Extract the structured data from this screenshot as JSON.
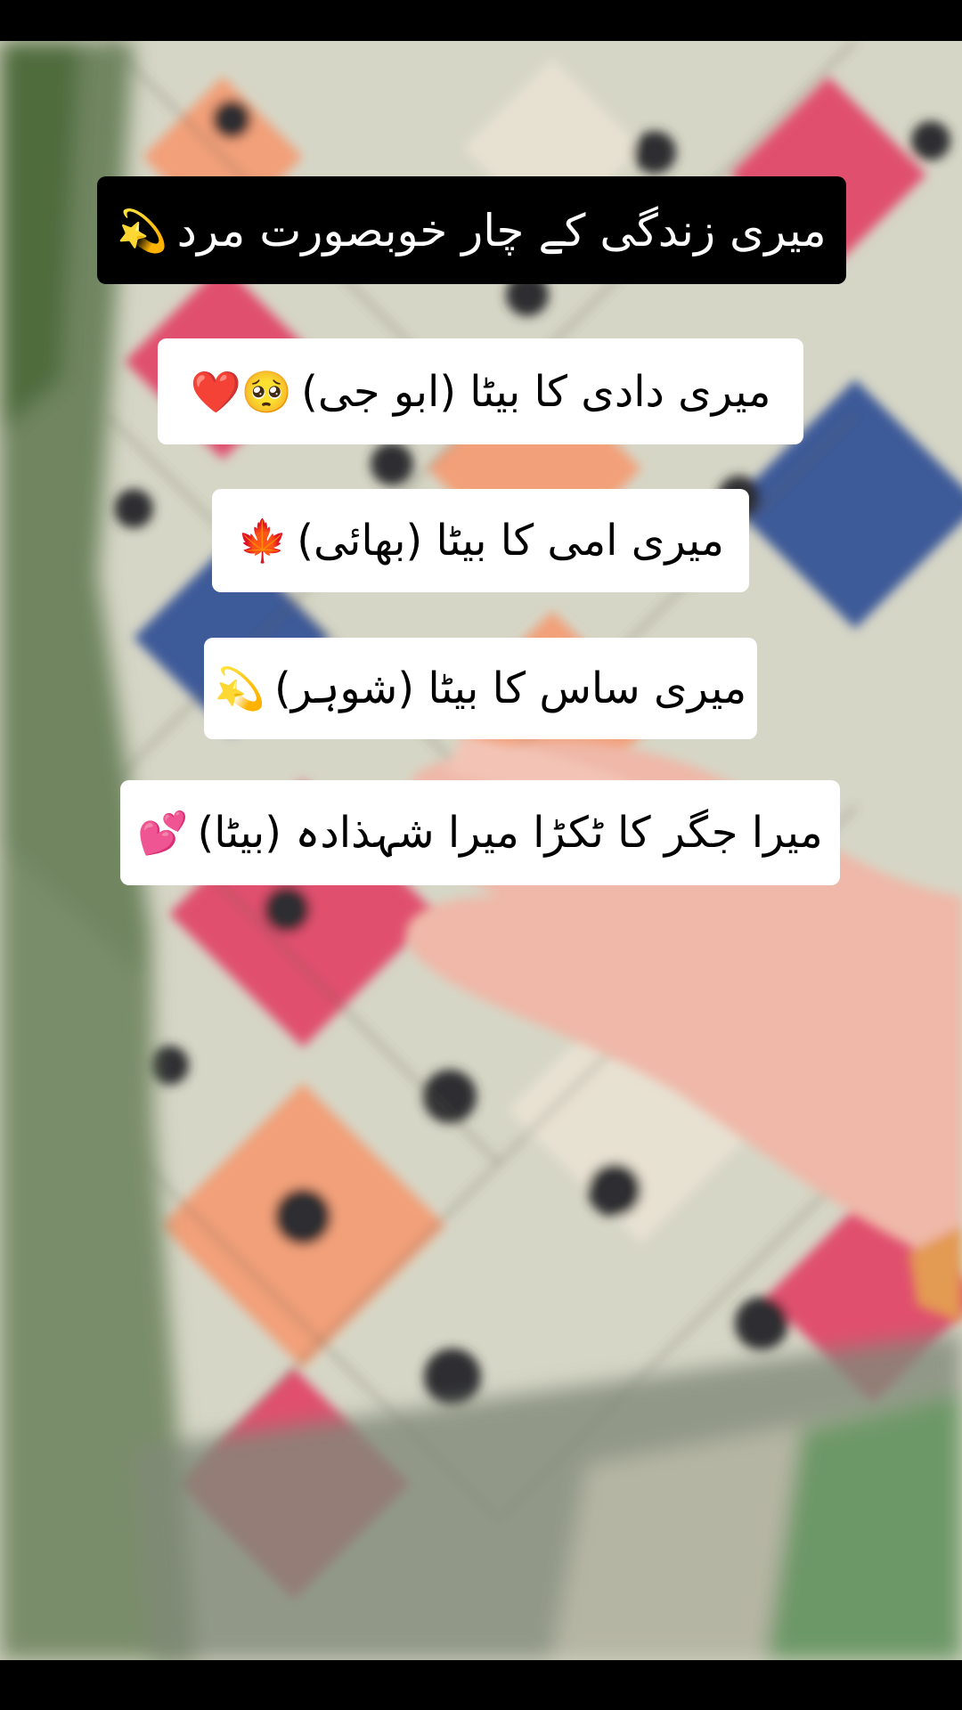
{
  "title": {
    "text": "میری زندگی کے چار خوبصورت مرد",
    "emoji": "💫"
  },
  "captions": [
    {
      "text": "میری دادی کا بیٹا (ابو جی)",
      "emoji": "🥺❤️"
    },
    {
      "text": "میری امی کا بیٹا (بھائی)",
      "emoji": "🍁"
    },
    {
      "text": "میری ساس کا بیٹا (شوہر)",
      "emoji": "💫"
    },
    {
      "text": "میرا جگر کا ٹکڑا میرا شہذادہ (بیٹا)",
      "emoji": "💕"
    }
  ],
  "colors": {
    "pink": "#e0506e",
    "peach": "#f2a079",
    "blue": "#3d5a99",
    "cream": "#d9d8c8",
    "green": "#5f7a4a",
    "skin": "#efb8a8"
  }
}
